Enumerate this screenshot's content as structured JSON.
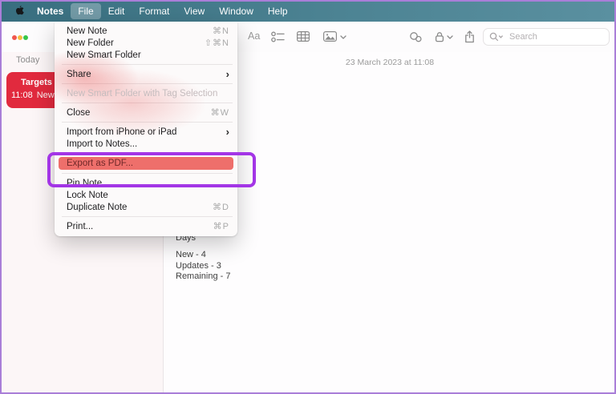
{
  "menubar": {
    "app_name": "Notes",
    "items": [
      "File",
      "Edit",
      "Format",
      "View",
      "Window",
      "Help"
    ],
    "active_item": "File"
  },
  "file_menu": {
    "items": [
      {
        "label": "New Note",
        "shortcut": "⌘N"
      },
      {
        "label": "New Folder",
        "shortcut": "⇧⌘N"
      },
      {
        "label": "New Smart Folder"
      },
      {
        "type": "separator"
      },
      {
        "label": "Share",
        "submenu": true
      },
      {
        "type": "separator"
      },
      {
        "label": "New Smart Folder with Tag Selection",
        "disabled": true
      },
      {
        "type": "separator"
      },
      {
        "label": "Close",
        "shortcut": "⌘W"
      },
      {
        "type": "separator"
      },
      {
        "label": "Import from iPhone or iPad",
        "submenu": true
      },
      {
        "label": "Import to Notes..."
      },
      {
        "type": "separator"
      },
      {
        "label": "Export as PDF...",
        "highlighted": true
      },
      {
        "type": "separator"
      },
      {
        "label": "Pin Note"
      },
      {
        "label": "Lock Note"
      },
      {
        "label": "Duplicate Note",
        "shortcut": "⌘D"
      },
      {
        "type": "separator"
      },
      {
        "label": "Print...",
        "shortcut": "⌘P"
      }
    ]
  },
  "toolbar": {
    "format_label": "Aa",
    "search_placeholder": "Search",
    "icons": [
      "checklist-icon",
      "table-icon",
      "media-icon",
      "collaborate-icon",
      "lock-icon",
      "share-icon",
      "search-icon"
    ]
  },
  "sidebar": {
    "section_label": "Today",
    "note": {
      "title": "Targets",
      "time": "11:08",
      "preview": "New"
    }
  },
  "note": {
    "date_line": "23 March 2023 at 11:08",
    "title": "Days",
    "lines": [
      "New - 4",
      "Updates - 3",
      "Remaining - 7"
    ]
  },
  "colors": {
    "highlight_annotation": "#a335e6",
    "menu_item_highlight": "#ee6f6b",
    "selected_note_card": "#e12a3e",
    "menubar_teal": "#4c8393",
    "frame_border": "#a97ed8"
  }
}
